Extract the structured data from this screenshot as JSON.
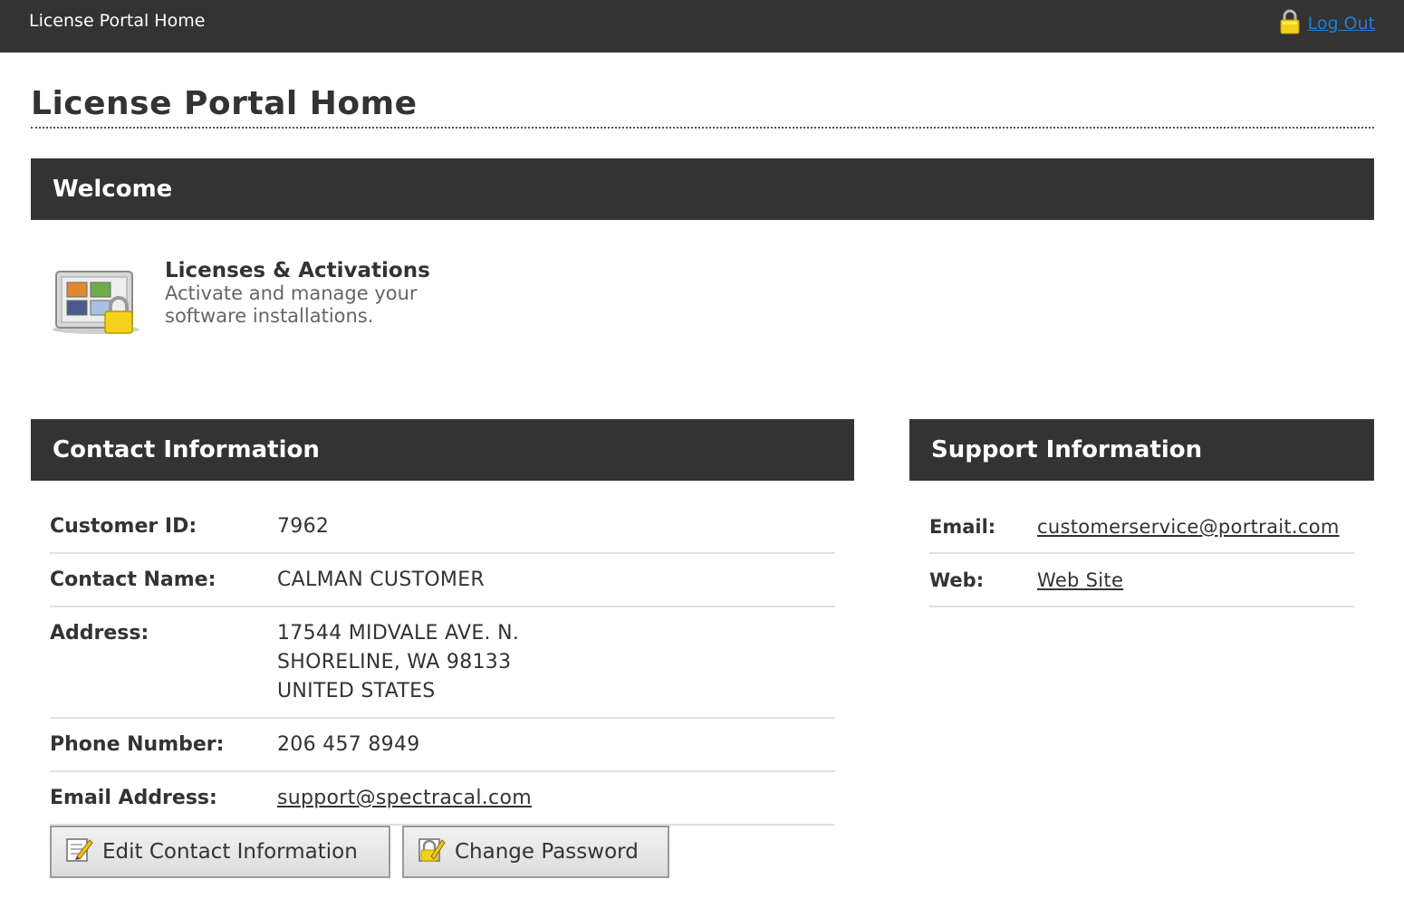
{
  "topbar": {
    "title": "License Portal Home",
    "logout_label": "Log Out"
  },
  "page": {
    "title": "License Portal Home"
  },
  "welcome": {
    "heading": "Welcome",
    "tile": {
      "title": "Licenses & Activations",
      "description": "Activate and manage your software installations."
    }
  },
  "contact": {
    "heading": "Contact Information",
    "rows": [
      {
        "label": "Customer ID:",
        "value": "7962"
      },
      {
        "label": "Contact Name:",
        "value": "CALMAN CUSTOMER"
      },
      {
        "label": "Address:",
        "value_lines": [
          "17544 MIDVALE AVE. N.",
          "SHORELINE, WA 98133",
          "UNITED STATES"
        ]
      },
      {
        "label": "Phone Number:",
        "value": "206 457 8949"
      },
      {
        "label": "Email Address:",
        "value": "support@spectracal.com"
      }
    ],
    "edit_button_label": "Edit Contact Information",
    "password_button_label": "Change Password"
  },
  "support": {
    "heading": "Support Information",
    "rows": [
      {
        "label": "Email:",
        "value": "customerservice@portrait.com"
      },
      {
        "label": "Web:",
        "value": "Web Site"
      }
    ]
  },
  "colors": {
    "bar": "#333333",
    "link": "#1f80d6",
    "rule": "#e0e0e0"
  },
  "icons": [
    "lock-icon",
    "licenses-icon",
    "edit-icon",
    "password-icon"
  ]
}
